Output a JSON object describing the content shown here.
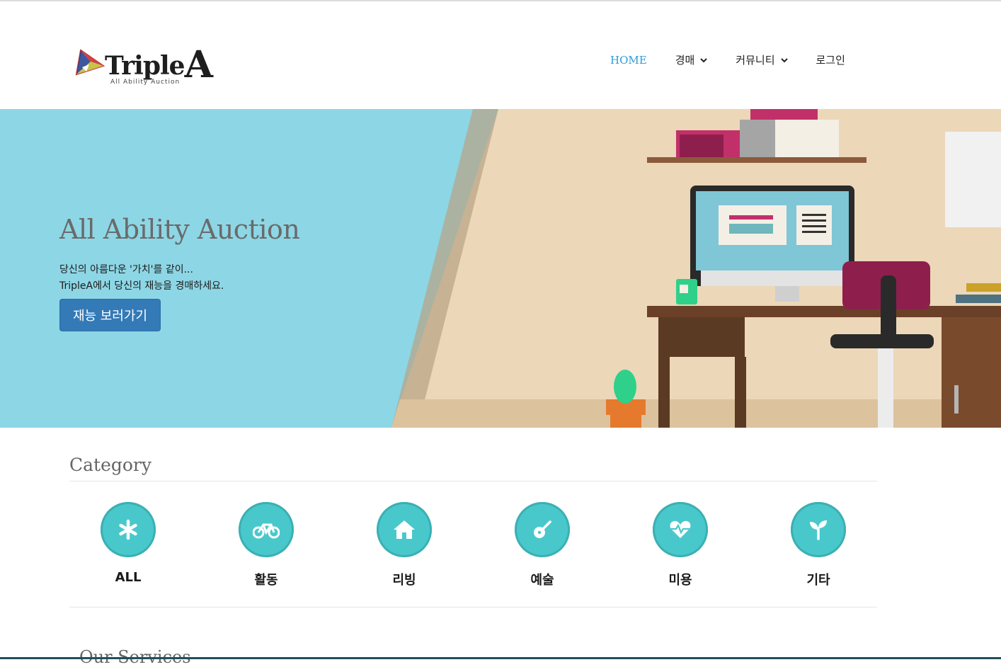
{
  "brand": {
    "name_main": "Triple",
    "name_big": "A",
    "tagline": "All Ability  Auction"
  },
  "nav": {
    "items": [
      {
        "label": "HOME",
        "active": true,
        "dropdown": false
      },
      {
        "label": "경매",
        "active": false,
        "dropdown": true
      },
      {
        "label": "커뮤니티",
        "active": false,
        "dropdown": true
      },
      {
        "label": "로그인",
        "active": false,
        "dropdown": false
      }
    ]
  },
  "hero": {
    "title": "All Ability Auction",
    "line1": "당신의 아름다운 '가치'를 같이...",
    "line2": "TripleA에서 당신의 재능을 경매하세요.",
    "button": "재능 보러가기"
  },
  "category": {
    "title": "Category",
    "items": [
      {
        "label": "ALL",
        "icon": "asterisk-icon"
      },
      {
        "label": "활동",
        "icon": "bicycle-icon"
      },
      {
        "label": "리빙",
        "icon": "home-icon"
      },
      {
        "label": "예술",
        "icon": "guitar-icon"
      },
      {
        "label": "미용",
        "icon": "heartbeat-icon"
      },
      {
        "label": "기타",
        "icon": "sprout-icon"
      }
    ]
  },
  "next_section": {
    "title": "Our Services"
  },
  "colors": {
    "accent": "#2d9bd8",
    "button": "#337ab7",
    "category_circle": "#49c8cc",
    "hero_left": "#8dd6e5"
  }
}
